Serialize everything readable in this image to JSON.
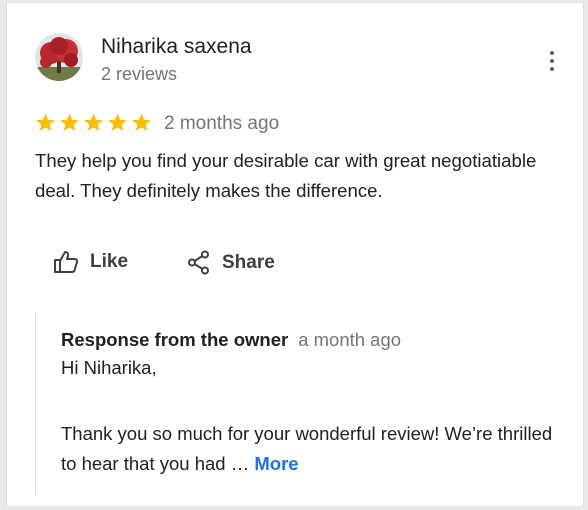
{
  "review": {
    "author": {
      "name": "Niharika saxena",
      "reviews_count": "2 reviews",
      "avatar_colors": [
        "#b8262e",
        "#6f7a45",
        "#dfe6ea"
      ]
    },
    "rating": 5,
    "max_rating": 5,
    "star_color": "#fbbc04",
    "time": "2 months ago",
    "text": "They help you find your desirable car with great negotiatiable deal. They definitely makes the difference.",
    "more_options_icon": "vertical-dots-icon"
  },
  "actions": {
    "like_label": "Like",
    "like_icon": "thumb-up-icon",
    "share_label": "Share",
    "share_icon": "share-icon"
  },
  "owner_response": {
    "label": "Response from the owner",
    "time": "a month ago",
    "greeting": "Hi Niharika,",
    "body": "Thank you so much for your wonderful review! We’re thrilled to hear that you had …",
    "more_label": "More",
    "link_color": "#1a73e8"
  }
}
